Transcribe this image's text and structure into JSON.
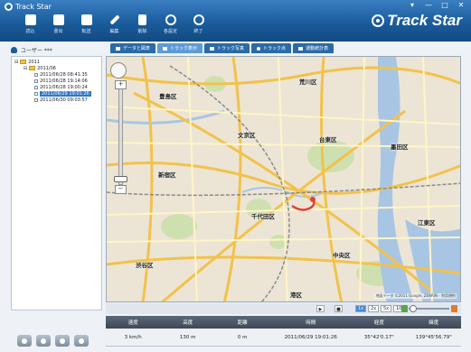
{
  "window": {
    "title": "Track Star",
    "min_label": "▾",
    "restore_label": "—",
    "max_label": "□",
    "close_label": "✕"
  },
  "brand": "Track Star",
  "toolbar": [
    {
      "label": "読込",
      "icon": "folder-open-icon"
    },
    {
      "label": "書出",
      "icon": "export-icon"
    },
    {
      "label": "転送",
      "icon": "transfer-icon"
    },
    {
      "label": "編集",
      "icon": "pencil-icon"
    },
    {
      "label": "削除",
      "icon": "trash-icon"
    },
    {
      "label": "各設定",
      "icon": "settings-icon"
    },
    {
      "label": "終了",
      "icon": "power-icon"
    }
  ],
  "user": {
    "label": "ユーザー ***"
  },
  "tree": {
    "year": "2011",
    "month": "2011/06",
    "items": [
      "2011/06/28 08:41:35",
      "2011/06/28 19:14:06",
      "2011/06/28 19:00:24",
      "2011/06/29 19:01:26",
      "2011/06/30 09:03:57"
    ],
    "selected_index": 3
  },
  "tabs": [
    {
      "label": "データと図表",
      "icon": "chart-icon"
    },
    {
      "label": "トラック表示",
      "icon": "track-icon"
    },
    {
      "label": "トラック写真",
      "icon": "camera-icon"
    },
    {
      "label": "トラック点",
      "icon": "pin-icon"
    },
    {
      "label": "運動統計表",
      "icon": "stats-icon"
    }
  ],
  "active_tab": 1,
  "map": {
    "labels": [
      "荒川区",
      "豊島区",
      "文京区",
      "台東区",
      "新宿区",
      "墨田区",
      "千代田区",
      "中央区",
      "渋谷区",
      "港区",
      "江東区"
    ],
    "zoom_in": "+",
    "zoom_out": "−",
    "copyright": "地図データ ©2011 Google, ZENRIN - 利用規約"
  },
  "playback": {
    "play": "▶",
    "stop": "■",
    "speeds": [
      "1x",
      "2x",
      "5x",
      "10x"
    ],
    "active_speed": 0,
    "position": 0.0
  },
  "stats": {
    "headers": [
      "速度",
      "高度",
      "距離",
      "時間",
      "経度",
      "緯度"
    ],
    "values": [
      "3 km/h",
      "130 m",
      "0 m",
      "2011/06/29 19:01:26",
      "35°42'0.17\"",
      "139°45'56.79\""
    ]
  },
  "colors": {
    "titlebar": "#1a5c9c",
    "tab_active": "#5f9ad8",
    "selection": "#2f76c8",
    "table_header": "#4a5665",
    "route": "#e2403a"
  }
}
